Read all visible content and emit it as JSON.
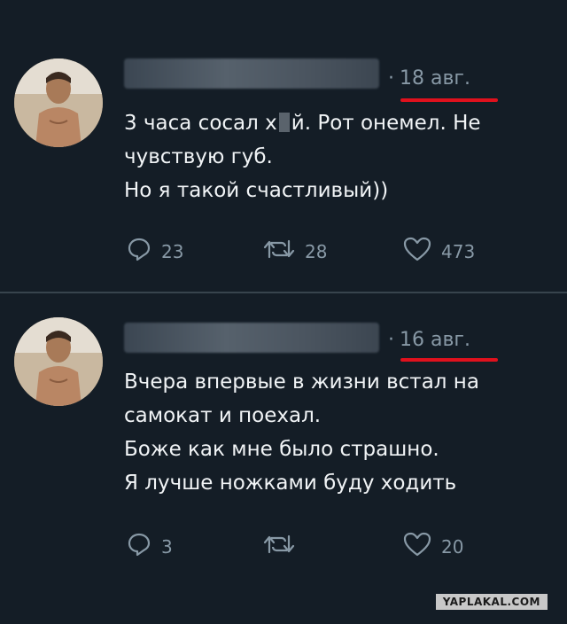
{
  "tweets": [
    {
      "date": "18 авг.",
      "line1_before": "3 часа сосал х",
      "line1_after": "й.  Рот онемел.  Не",
      "line2": "чувствую губ.",
      "line3": "Но я такой счастливый))",
      "replies": "23",
      "retweets": "28",
      "likes": "473"
    },
    {
      "date": "16 авг.",
      "line1": "Вчера впервые в жизни встал на",
      "line2": "самокат и поехал.",
      "line3": "Боже как мне было страшно.",
      "line4": "Я лучше ножками буду ходить",
      "replies": "3",
      "retweets": "",
      "likes": "20"
    }
  ],
  "separator_dot": "·",
  "icons": [
    "reply-icon",
    "retweet-icon",
    "like-icon"
  ],
  "colors": {
    "background": "#141d26",
    "underline": "#e0111d",
    "muted": "#8899a6"
  },
  "watermark": "YAPLAKAL.COM"
}
